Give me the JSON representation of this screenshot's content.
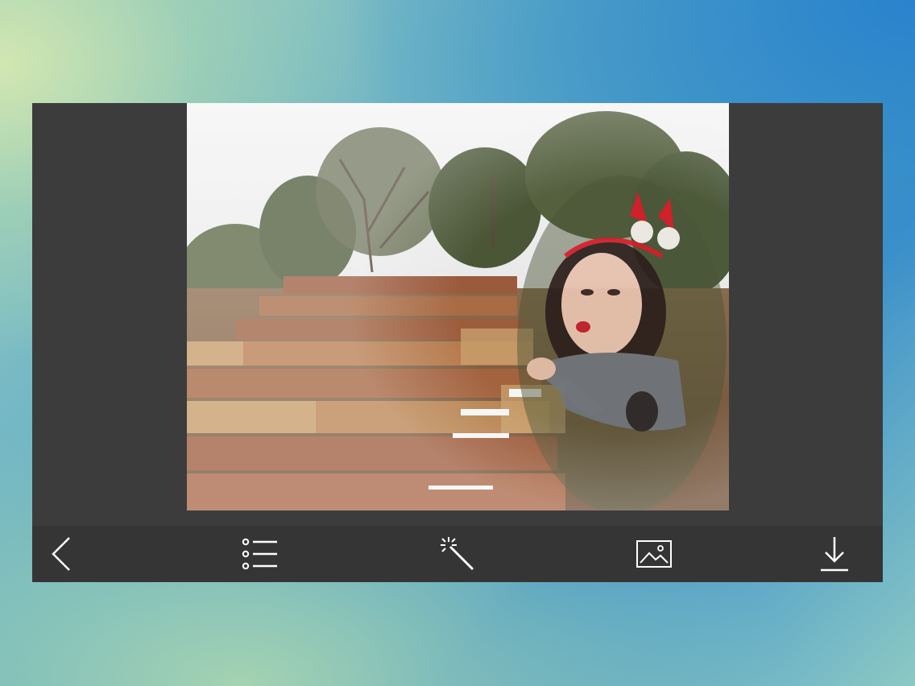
{
  "editor": {
    "photo": {
      "description_icon": "photo-composite"
    }
  },
  "toolbar": {
    "items": [
      {
        "icon": "chevron-left-icon"
      },
      {
        "icon": "list-icon"
      },
      {
        "icon": "magic-wand-icon"
      },
      {
        "icon": "image-icon"
      },
      {
        "icon": "download-icon"
      }
    ],
    "icon_color": "#ffffff"
  },
  "colors": {
    "panel": "#3c3c3d",
    "toolbar": "#353536"
  }
}
